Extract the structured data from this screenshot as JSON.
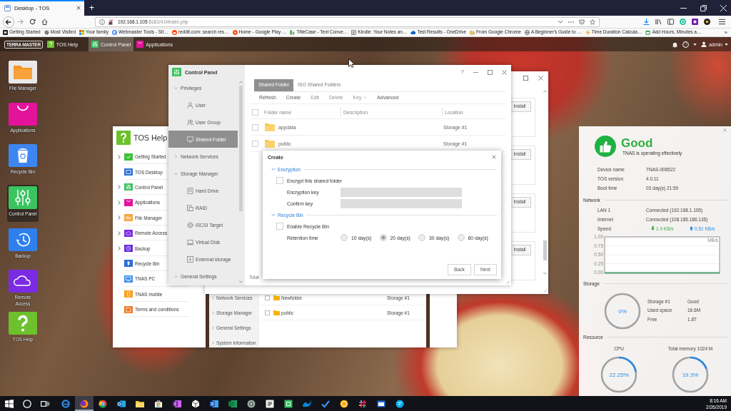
{
  "browser": {
    "tabs": [
      {
        "title": "Desktop - TOS",
        "selected": true
      }
    ],
    "new_tab": "+",
    "address": {
      "host": "192.168.1.105",
      "rest": ":8181/4.0/index.php"
    },
    "bookmarks": [
      "Getting Started",
      "Most Visited",
      "Your family",
      "Webmaster Tools - Sit…",
      "reddit.com: search res…",
      "Home - Google Play …",
      "TitleCase - Text Conve…",
      "Kindle: Your Notes an…",
      "Test Results - OneDrive",
      "From Google Chrome",
      "A Beginner's Guide to …",
      "Time Duration Calcula…",
      "Add Hours, Minutes a…"
    ],
    "bookmarks_more": "»"
  },
  "tos_bar": {
    "logo": "TERRA MASTER",
    "apps": [
      {
        "label": "TOS Help",
        "selected": false
      },
      {
        "label": "Control Panel",
        "selected": true
      },
      {
        "label": "Applications",
        "selected": false
      }
    ],
    "user": "admin"
  },
  "desktop_icons": [
    {
      "label": "File Manager",
      "selected": false
    },
    {
      "label": "Applications",
      "selected": false
    },
    {
      "label": "Recycle Bin",
      "selected": false
    },
    {
      "label": "Control Panel",
      "selected": true
    },
    {
      "label": "Backup",
      "selected": false
    },
    {
      "label": "Remote Access",
      "selected": false
    },
    {
      "label": "TOS Help",
      "selected": false
    }
  ],
  "help_window": {
    "title": "TOS Help",
    "items": [
      {
        "label": "Getting Started",
        "expandable": true
      },
      {
        "label": "TOS Desktop",
        "expandable": false
      },
      {
        "label": "Control Panel",
        "expandable": true
      },
      {
        "label": "Applications",
        "expandable": true
      },
      {
        "label": "File Manager",
        "expandable": true
      },
      {
        "label": "Remote Access",
        "expandable": true
      },
      {
        "label": "Backup",
        "expandable": true
      },
      {
        "label": "Recycle Bin",
        "expandable": false
      },
      {
        "label": "TNAS PC",
        "expandable": false
      },
      {
        "label": "TNAS mobile",
        "expandable": false
      },
      {
        "label": "Terms and conditions",
        "expandable": false
      }
    ],
    "screenshot": {
      "sidebar": [
        "Network Services",
        "Storage Manager",
        "General Settings",
        "System information"
      ],
      "rows": [
        {
          "name": "Newfolder",
          "location": "Storage #1",
          "checked": false
        },
        {
          "name": "public",
          "location": "Storage #1",
          "checked": false
        }
      ]
    }
  },
  "app_window": {
    "buttons": [
      "Install",
      "Install",
      "Install",
      "Install"
    ]
  },
  "control_panel": {
    "title": "Control Panel",
    "help": "?",
    "nav": [
      {
        "label": "Privileges",
        "expanded": true,
        "children": [
          {
            "label": "User",
            "selected": false
          },
          {
            "label": "User Group",
            "selected": false
          },
          {
            "label": "Shared Folder",
            "selected": true
          }
        ]
      },
      {
        "label": "Network Services",
        "expanded": false
      },
      {
        "label": "Storage Manager",
        "expanded": true,
        "children": [
          {
            "label": "Hard Drive",
            "selected": false
          },
          {
            "label": "RAID",
            "selected": false
          },
          {
            "label": "iSCSI Target",
            "selected": false
          },
          {
            "label": "Virtual Disk",
            "selected": false
          },
          {
            "label": "External storage",
            "selected": false
          }
        ]
      },
      {
        "label": "General Settings",
        "expanded": true
      }
    ],
    "tabs": [
      {
        "label": "Shared Folder",
        "selected": true
      },
      {
        "label": "ISO Shared Folders",
        "selected": false
      }
    ],
    "toolbar": [
      {
        "label": "Refresh",
        "disabled": false,
        "dropdown": false
      },
      {
        "label": "Create",
        "disabled": false,
        "dropdown": false
      },
      {
        "label": "Edit",
        "disabled": true,
        "dropdown": false
      },
      {
        "label": "Delete",
        "disabled": true,
        "dropdown": false
      },
      {
        "label": "Key",
        "disabled": true,
        "dropdown": true
      },
      {
        "label": "Advanced",
        "disabled": false,
        "dropdown": false
      }
    ],
    "table": {
      "header_checked": false,
      "columns": [
        "Folder name",
        "Description",
        "Location"
      ],
      "rows": [
        {
          "name": "appdata",
          "location": "Storage #1",
          "checked": false
        },
        {
          "name": "public",
          "location": "Storage #1",
          "checked": false
        }
      ]
    },
    "footer": "Total"
  },
  "create_dialog": {
    "title": "Create",
    "sections": [
      {
        "title": "Encryption",
        "expanded": true,
        "fields": [
          {
            "kind": "checkbox",
            "label": "Encrypt this shared folder",
            "checked": false
          },
          {
            "kind": "input",
            "label": "Encryption key",
            "disabled": true
          },
          {
            "kind": "input",
            "label": "Confirm key",
            "disabled": true
          }
        ]
      },
      {
        "title": "Recycle Bin",
        "expanded": true,
        "fields": [
          {
            "kind": "checkbox",
            "label": "Enable Recycle Bin",
            "checked": false
          },
          {
            "kind": "radio",
            "label": "Retention time",
            "disabled": true,
            "options": [
              {
                "label": "10 day(s)",
                "selected": false
              },
              {
                "label": "20 day(s)",
                "selected": true
              },
              {
                "label": "30 day(s)",
                "selected": false
              },
              {
                "label": "60 day(s)",
                "selected": false
              }
            ]
          }
        ]
      }
    ],
    "buttons": [
      "Back",
      "Next"
    ]
  },
  "status_widget": {
    "status": "Good",
    "message": "TNAS is operating effectively",
    "info": [
      {
        "label": "Device name",
        "value": "TNAS-008522"
      },
      {
        "label": "TOS version",
        "value": "4.0.11"
      },
      {
        "label": "Boot time",
        "value": "03 day(s) 21:59"
      }
    ],
    "network": {
      "title": "Network",
      "rows": [
        {
          "label": "LAN 1",
          "value": "Connected (192.168.1.105)"
        },
        {
          "label": "Internet",
          "value": "Connected (108.185.186.135)"
        }
      ],
      "speed": {
        "label": "Speed",
        "download": "1.9 KB/s",
        "upload": "0.51 KB/s"
      },
      "chart_data": {
        "type": "line",
        "ylabel": "MB/s",
        "grid": true,
        "ylim": [
          0,
          1
        ],
        "yticks": [
          {
            "value": 0,
            "label": "0.00"
          },
          {
            "value": 0.25,
            "label": "0.25"
          },
          {
            "value": 0.5,
            "label": "0.50"
          },
          {
            "value": 0.75,
            "label": "0.75"
          },
          {
            "value": 1,
            "label": "1.00"
          }
        ],
        "values": [
          0,
          0,
          0,
          0,
          0,
          0,
          0,
          0,
          0,
          0,
          0,
          0,
          0,
          0,
          0,
          0,
          0,
          0,
          0,
          0
        ]
      }
    },
    "storage": {
      "title": "Storage",
      "level": 0,
      "reading": "0%",
      "rows": [
        {
          "label": "Storage #1",
          "value": "Good"
        },
        {
          "label": "Used space",
          "value": "16.6M"
        },
        {
          "label": "Free",
          "value": "1.8T"
        }
      ]
    },
    "resource": {
      "title": "Resource",
      "gauges": [
        {
          "label": "CPU",
          "reading": "22.25%",
          "level": 0.2225
        },
        {
          "label": "Total memory 1024 M",
          "reading": "19.3%",
          "level": 0.193
        }
      ]
    }
  },
  "taskbar": {
    "apps": [
      {
        "selected": false
      },
      {
        "selected": true
      },
      {
        "selected": false
      },
      {
        "selected": false
      },
      {
        "selected": false
      },
      {
        "selected": false
      },
      {
        "selected": false
      },
      {
        "selected": false
      },
      {
        "selected": false
      },
      {
        "selected": false
      },
      {
        "selected": false
      },
      {
        "selected": false
      },
      {
        "selected": false
      },
      {
        "selected": false
      },
      {
        "selected": false
      },
      {
        "selected": false
      },
      {
        "selected": false
      },
      {
        "selected": false
      },
      {
        "selected": false
      }
    ],
    "time": "8:16 AM",
    "date": "2/26/2019"
  }
}
